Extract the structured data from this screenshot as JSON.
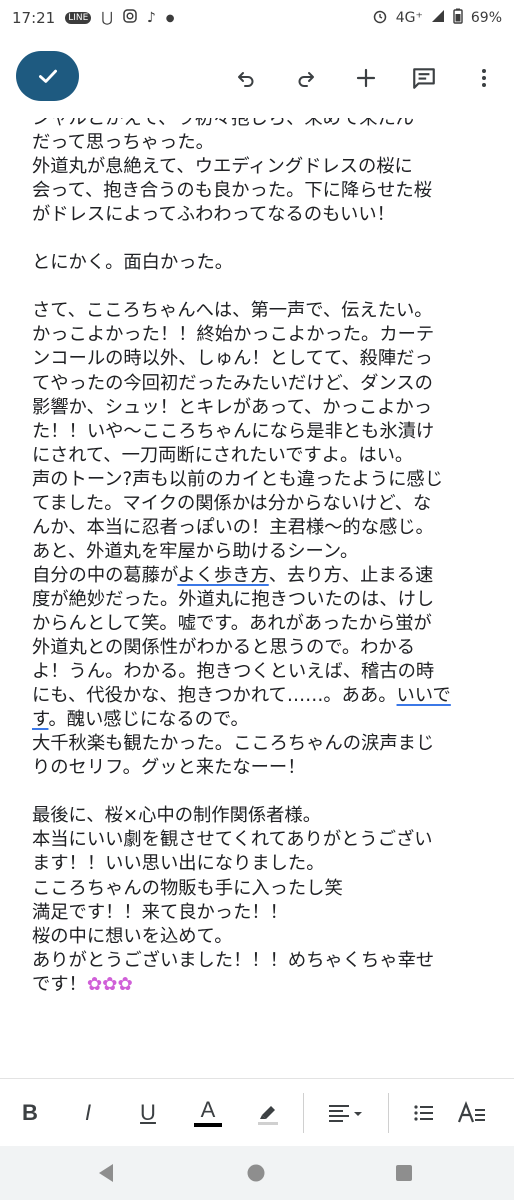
{
  "status": {
    "time": "17:21",
    "line_label": "LINE",
    "network": "4G⁺",
    "battery": "69%"
  },
  "toolbar": {
    "done_icon": "check-icon",
    "undo_icon": "undo-icon",
    "redo_icon": "redo-icon",
    "insert_icon": "plus-icon",
    "comment_icon": "comment-icon",
    "more_icon": "more-vert-icon"
  },
  "document": {
    "lines": [
      "シャルとかえて、ラ初々抱しら、来めて来たん",
      "だって思っちゃった。",
      "外道丸が息絶えて、ウエディングドレスの桜に",
      "会って、抱き合うのも良かった。下に降らせた桜",
      "がドレスによってふわわってなるのもいい！",
      "",
      "とにかく。面白かった。",
      "",
      "さて、こころちゃんへは、第一声で、伝えたい。",
      "かっこよかった！！終始かっこよかった。カーテ",
      "ンコールの時以外、しゅん！としてて、殺陣だっ",
      "てやったの今回初だったみたいだけど、ダンスの",
      "影響か、シュッ！とキレがあって、かっこよかっ",
      "た！！いや〜こころちゃんになら是非とも氷漬け",
      "にされて、一刀両断にされたいですよ。はい。",
      "声のトーン?声も以前のカイとも違ったように感じ",
      "てました。マイクの関係かは分からないけど、な",
      "んか、本当に忍者っぽいの！主君様〜的な感じ。",
      "あと、外道丸を牢屋から助けるシーン。",
      "自分の中の葛藤がよく歩き方、去り方、止まる速",
      "度が絶妙だった。外道丸に抱きついたのは、けし",
      "からんとして笑。嘘です。あれがあったから蛍が",
      "外道丸との関係性がわかると思うので。わかる",
      "よ！うん。わかる。抱きつくといえば、稽古の時",
      "にも、代役かな、抱きつかれて……。ああ。いいで",
      "す。醜い感じになるので。",
      "大千秋楽も観たかった。こころちゃんの涙声まじ",
      "りのセリフ。グッと来たなーー！",
      "",
      "最後に、桜×心中の制作関係者様。",
      "本当にいい劇を観させてくれてありがとうござい",
      "ます！！いい思い出になりました。",
      "こころちゃんの物販も手に入ったし笑",
      "満足です！！来て良かった！！",
      "桜の中に想いを込めて。",
      "ありがとうございました！！！めちゃくちゃ幸せ",
      "です！"
    ],
    "squiggle_1": "よく歩き方",
    "squiggle_2a": "いいで",
    "squiggle_2b": "す",
    "emoji": "✿✿✿"
  },
  "format_bar": {
    "bold": "B",
    "italic": "I",
    "underline": "U",
    "text_color": "A",
    "text_color_value": "#000000",
    "highlight_icon": "highlighter-icon",
    "align_icon": "align-left-icon",
    "list_icon": "bulleted-list-icon",
    "text_format_icon": "text-format-icon"
  },
  "nav": {
    "back_icon": "back-icon",
    "home_icon": "home-icon",
    "recents_icon": "recents-icon"
  },
  "colors": {
    "accent": "#1e5a80",
    "squiggle": "#3b78e7",
    "emoji": "#d05fd8"
  }
}
